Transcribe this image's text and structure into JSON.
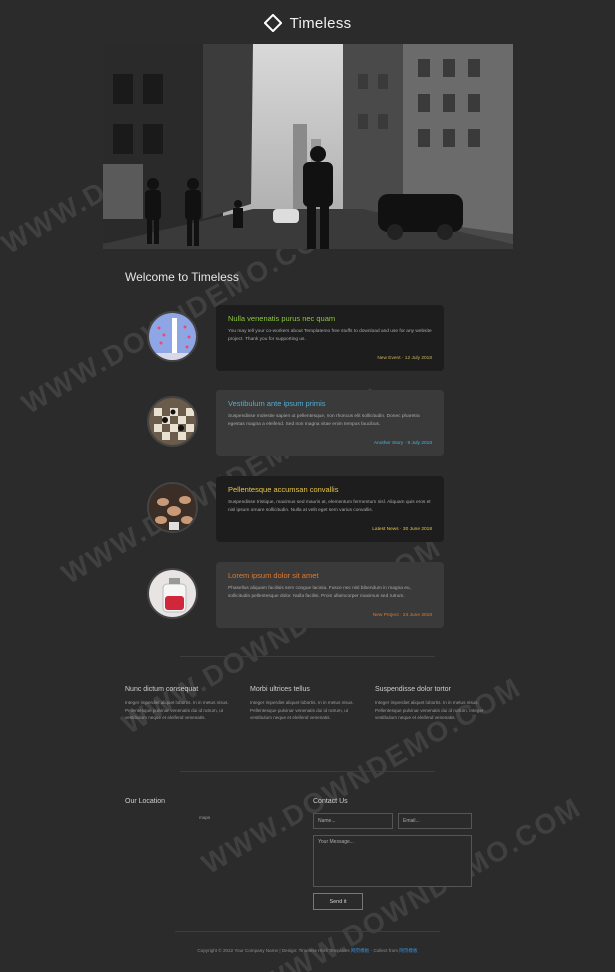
{
  "site": {
    "title": "Timeless"
  },
  "welcome": "Welcome to Timeless",
  "timeline": [
    {
      "title": "Nulla venenatis purus nec quam",
      "text": "You may tell your co-workers about Templatemo free stuffs to download and use for any website project. Thank you for supporting us.",
      "meta": "New Event · 12 July 2018",
      "title_color": "#8ec63f",
      "meta_color": "#c9b45a"
    },
    {
      "title": "Vestibulum ante ipsum primis",
      "text": "Suspendisse molestie sapien ut pellentesque, non rhoncus elit sollicitudin. Donec pharetra egestas magna a eleifend. Sed non magna vitae enim tempus faucibus.",
      "meta": "Another Story · 9 July 2018",
      "title_color": "#4ab0d9",
      "meta_color": "#4ab0d9"
    },
    {
      "title": "Pellentesque accumsan convallis",
      "text": "Suspendisse tristique, maximus sed mauris at, elementum fermentum nisl. Aliquam quis eros et nisl ipsum ornare sollicitudin. Nulla at velit eget sem varius convallis.",
      "meta": "Latest News · 30 June 2018",
      "title_color": "#e8c547",
      "meta_color": "#e8c547"
    },
    {
      "title": "Lorem ipsum dolor sit amet",
      "text": "Phasellus aliquam facilisis sem congue lacinia. Fusce nec nisl bibendum in magna eu, sollicitudin pellentesque dolor. Nulla facilisi. Proin ullamcorper maximus sed rutrum.",
      "meta": "New Project · 24 June 2018",
      "title_color": "#e07a2e",
      "meta_color": "#e07a2e"
    }
  ],
  "columns": [
    {
      "title": "Nunc dictum consequat",
      "text": "Integer imperdiet aliquet lobortis. In in metus nisus. Pellentesque pulvinar venenatis dui id rutrum, ut vestibulum neque et eleifend venenatis."
    },
    {
      "title": "Morbi ultrices tellus",
      "text": "Integer imperdiet aliquet lobortis. In in metus nisus. Pellentesque pulvinar venenatis dui id rutrum, ut vestibulum neque et eleifend venenatis."
    },
    {
      "title": "Suspendisse dolor tortor",
      "text": "Integer imperdiet aliquet lobortis. In in metus nisus. Pellentesque pulvinar venenatis dui id rutrum. Integer vestibulum neque et eleifend venenatis."
    }
  ],
  "location": {
    "title": "Our Location",
    "maps_label": "maps"
  },
  "contact": {
    "title": "Contact Us",
    "name_placeholder": "Name...",
    "email_placeholder": "Email...",
    "message_placeholder": "Your Message...",
    "send_label": "Send it"
  },
  "footer": {
    "text": "Copyright © 2022 Your Company Name | Design: Timeless Html Templates",
    "link1": "网页模板",
    "sep": " · Collect from ",
    "link2": "网页模板"
  },
  "watermark": "WWW.DOWNDEMO.COM",
  "colors": {
    "background": "#2b2b2b",
    "card_dark": "#1d1d1d",
    "card_light": "#3a3a3a",
    "link": "#3a8fd9"
  }
}
